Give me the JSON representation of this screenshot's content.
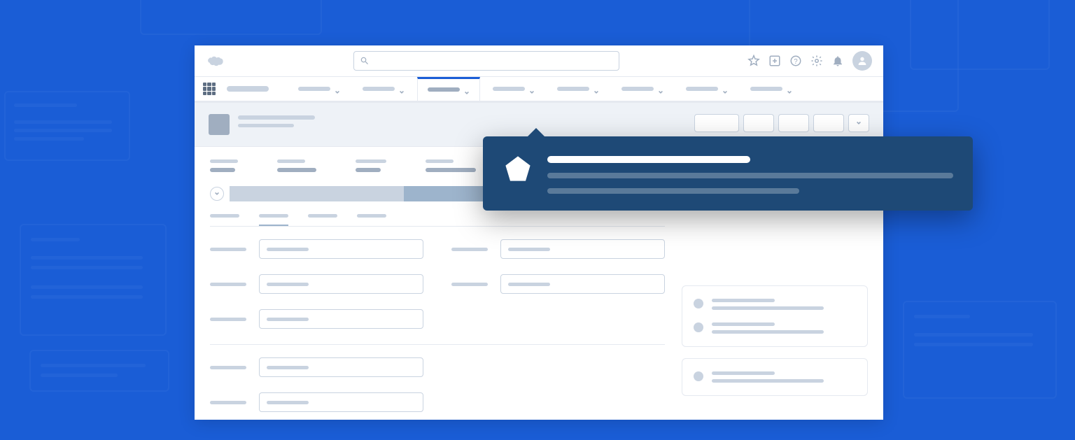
{
  "header": {
    "search_placeholder": "",
    "icons": [
      "favorite",
      "add",
      "help",
      "settings",
      "notifications",
      "profile"
    ]
  },
  "nav": {
    "app_name": "",
    "tabs": [
      {
        "label": "",
        "active": false
      },
      {
        "label": "",
        "active": false
      },
      {
        "label": "",
        "active": true
      },
      {
        "label": "",
        "active": false
      },
      {
        "label": "",
        "active": false
      },
      {
        "label": "",
        "active": false
      },
      {
        "label": "",
        "active": false
      },
      {
        "label": "",
        "active": false
      }
    ]
  },
  "page": {
    "title": "",
    "subtitle": "",
    "actions": [
      "",
      "",
      "",
      "",
      ""
    ]
  },
  "summary_fields": [
    {
      "label": "",
      "value": ""
    },
    {
      "label": "",
      "value": ""
    },
    {
      "label": "",
      "value": ""
    },
    {
      "label": "",
      "value": ""
    }
  ],
  "path_steps": [
    {
      "state": "complete"
    },
    {
      "state": "complete"
    },
    {
      "state": "current"
    },
    {
      "state": "future"
    },
    {
      "state": "future"
    }
  ],
  "detail_tabs": [
    {
      "label": "",
      "active": false
    },
    {
      "label": "",
      "active": true
    },
    {
      "label": "",
      "active": false
    },
    {
      "label": "",
      "active": false
    }
  ],
  "form_sections": [
    {
      "rows": [
        {
          "fields": [
            {
              "label": "",
              "value": ""
            },
            {
              "label": "",
              "value": ""
            }
          ]
        },
        {
          "fields": [
            {
              "label": "",
              "value": ""
            },
            {
              "label": "",
              "value": ""
            }
          ]
        },
        {
          "fields": [
            {
              "label": "",
              "value": ""
            }
          ]
        }
      ]
    },
    {
      "rows": [
        {
          "fields": [
            {
              "label": "",
              "value": ""
            }
          ]
        },
        {
          "fields": [
            {
              "label": "",
              "value": ""
            }
          ]
        }
      ]
    }
  ],
  "sidebar_panels": [
    {
      "items": [
        {
          "line1": "",
          "line2": ""
        },
        {
          "line1": "",
          "line2": ""
        }
      ]
    },
    {
      "items": [
        {
          "line1": "",
          "line2": ""
        }
      ]
    }
  ],
  "popover": {
    "title": "",
    "body_line1": "",
    "body_line2": ""
  },
  "colors": {
    "background": "#1a5dd6",
    "popover_bg": "#1e4976",
    "skeleton_light": "#c9d3e0",
    "skeleton_mid": "#a0aec0"
  }
}
